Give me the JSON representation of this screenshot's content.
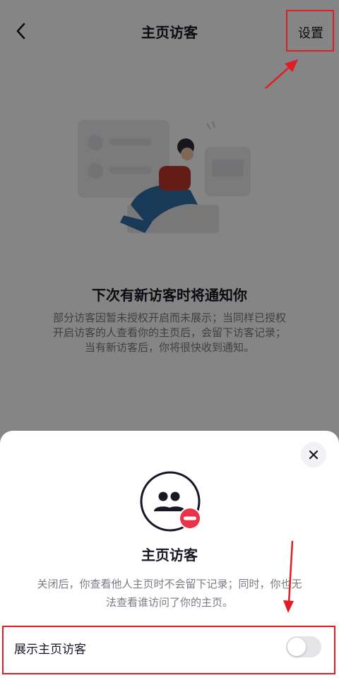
{
  "nav": {
    "title": "主页访客",
    "settings_label": "设置"
  },
  "empty": {
    "title": "下次有新访客时将通知你",
    "desc_lines": [
      "部分访客因暂未授权开启而未展示；当同样已授权",
      "开启访客的人查看你的主页后，会留下访客记录；",
      "当有新访客后，你将很快收到通知。"
    ]
  },
  "sheet": {
    "title": "主页访客",
    "desc_lines": [
      "关闭后，你查看他人主页时不会留下记录；同时，你也无",
      "法查看谁访问了你的主页。"
    ],
    "toggle_label": "展示主页访客",
    "toggle_on": false
  },
  "colors": {
    "annotation": "#e11d24",
    "badge": "#e8334a",
    "text": "#161823"
  },
  "icons": [
    "back-arrow-icon",
    "close-icon",
    "visitors-off-icon"
  ]
}
